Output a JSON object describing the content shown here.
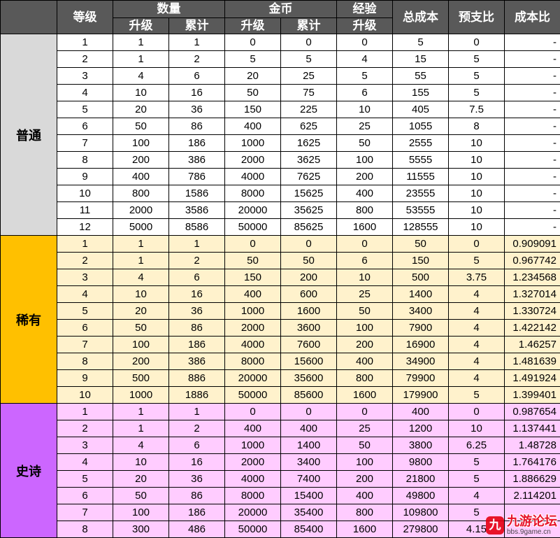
{
  "header": {
    "level": "等级",
    "quantity": "数量",
    "gold": "金币",
    "exp": "经验",
    "total_cost": "总成本",
    "prepay_ratio": "预支比",
    "cost_ratio": "成本比",
    "sub_upgrade": "升级",
    "sub_cumulative": "累计"
  },
  "groups": [
    {
      "name": "普通",
      "rows": [
        [
          "1",
          "1",
          "1",
          "0",
          "0",
          "0",
          "5",
          "0",
          "-"
        ],
        [
          "2",
          "1",
          "2",
          "5",
          "5",
          "4",
          "15",
          "5",
          "-"
        ],
        [
          "3",
          "4",
          "6",
          "20",
          "25",
          "5",
          "55",
          "5",
          "-"
        ],
        [
          "4",
          "10",
          "16",
          "50",
          "75",
          "6",
          "155",
          "5",
          "-"
        ],
        [
          "5",
          "20",
          "36",
          "150",
          "225",
          "10",
          "405",
          "7.5",
          "-"
        ],
        [
          "6",
          "50",
          "86",
          "400",
          "625",
          "25",
          "1055",
          "8",
          "-"
        ],
        [
          "7",
          "100",
          "186",
          "1000",
          "1625",
          "50",
          "2555",
          "10",
          "-"
        ],
        [
          "8",
          "200",
          "386",
          "2000",
          "3625",
          "100",
          "5555",
          "10",
          "-"
        ],
        [
          "9",
          "400",
          "786",
          "4000",
          "7625",
          "200",
          "11555",
          "10",
          "-"
        ],
        [
          "10",
          "800",
          "1586",
          "8000",
          "15625",
          "400",
          "23555",
          "10",
          "-"
        ],
        [
          "11",
          "2000",
          "3586",
          "20000",
          "35625",
          "800",
          "53555",
          "10",
          "-"
        ],
        [
          "12",
          "5000",
          "8586",
          "50000",
          "85625",
          "1600",
          "128555",
          "10",
          "-"
        ]
      ]
    },
    {
      "name": "稀有",
      "rows": [
        [
          "1",
          "1",
          "1",
          "0",
          "0",
          "0",
          "50",
          "0",
          "0.909091"
        ],
        [
          "2",
          "1",
          "2",
          "50",
          "50",
          "6",
          "150",
          "5",
          "0.967742"
        ],
        [
          "3",
          "4",
          "6",
          "150",
          "200",
          "10",
          "500",
          "3.75",
          "1.234568"
        ],
        [
          "4",
          "10",
          "16",
          "400",
          "600",
          "25",
          "1400",
          "4",
          "1.327014"
        ],
        [
          "5",
          "20",
          "36",
          "1000",
          "1600",
          "50",
          "3400",
          "4",
          "1.330724"
        ],
        [
          "6",
          "50",
          "86",
          "2000",
          "3600",
          "100",
          "7900",
          "4",
          "1.422142"
        ],
        [
          "7",
          "100",
          "186",
          "4000",
          "7600",
          "200",
          "16900",
          "4",
          "1.46257"
        ],
        [
          "8",
          "200",
          "386",
          "8000",
          "15600",
          "400",
          "34900",
          "4",
          "1.481639"
        ],
        [
          "9",
          "500",
          "886",
          "20000",
          "35600",
          "800",
          "79900",
          "4",
          "1.491924"
        ],
        [
          "10",
          "1000",
          "1886",
          "50000",
          "85600",
          "1600",
          "179900",
          "5",
          "1.399401"
        ]
      ]
    },
    {
      "name": "史诗",
      "rows": [
        [
          "1",
          "1",
          "1",
          "0",
          "0",
          "0",
          "400",
          "0",
          "0.987654"
        ],
        [
          "2",
          "1",
          "2",
          "400",
          "400",
          "25",
          "1200",
          "10",
          "1.137441"
        ],
        [
          "3",
          "4",
          "6",
          "1000",
          "1400",
          "50",
          "3800",
          "6.25",
          "1.48728"
        ],
        [
          "4",
          "10",
          "16",
          "2000",
          "3400",
          "100",
          "9800",
          "5",
          "1.764176"
        ],
        [
          "5",
          "20",
          "36",
          "4000",
          "7400",
          "200",
          "21800",
          "5",
          "1.886629"
        ],
        [
          "6",
          "50",
          "86",
          "8000",
          "15400",
          "400",
          "49800",
          "4",
          "2.114201"
        ],
        [
          "7",
          "100",
          "186",
          "20000",
          "35400",
          "800",
          "109800",
          "5",
          ""
        ],
        [
          "8",
          "300",
          "486",
          "50000",
          "85400",
          "1600",
          "279800",
          "4.15",
          ""
        ]
      ]
    }
  ],
  "watermark": {
    "badge": "九",
    "title": "九游论坛",
    "url": "bbs.9game.cn"
  },
  "colors": {
    "header_bg": "#595959",
    "common_label_bg": "#d9d9d9",
    "rare_label_bg": "#ffc000",
    "rare_row_bg": "#fff2cc",
    "epic_label_bg": "#cc66ff",
    "epic_row_bg": "#ffccff"
  }
}
